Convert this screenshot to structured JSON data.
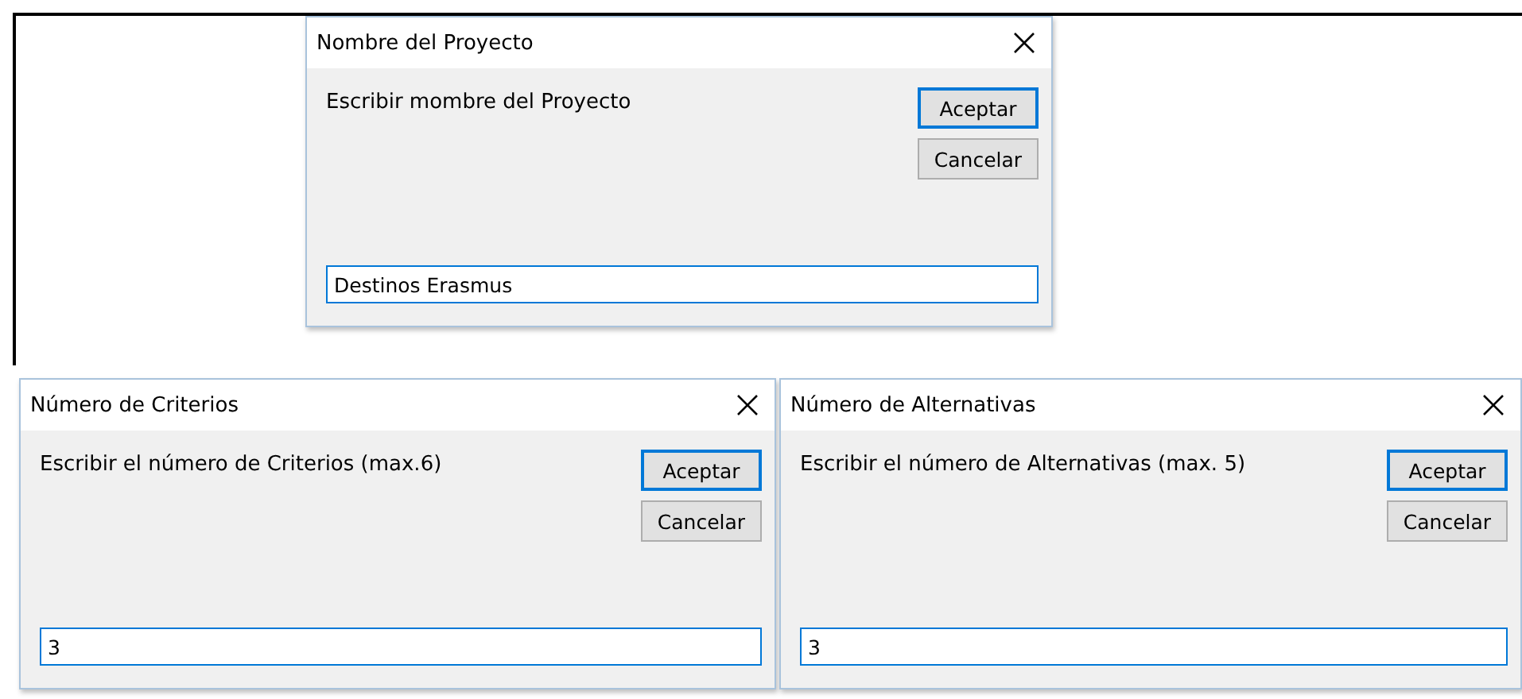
{
  "dialogs": [
    {
      "title": "Nombre del Proyecto",
      "prompt": "Escribir mombre del Proyecto",
      "buttons": [
        {
          "label": "Aceptar",
          "default": true
        },
        {
          "label": "Cancelar",
          "default": false
        }
      ],
      "value": "Destinos Erasmus"
    },
    {
      "title": "Número de Criterios",
      "prompt": "Escribir el número de Criterios (max.6)",
      "buttons": [
        {
          "label": "Aceptar",
          "default": true
        },
        {
          "label": "Cancelar",
          "default": false
        }
      ],
      "value": "3"
    },
    {
      "title": "Número de Alternativas",
      "prompt": "Escribir el número de Alternativas (max. 5)",
      "buttons": [
        {
          "label": "Aceptar",
          "default": true
        },
        {
          "label": "Cancelar",
          "default": false
        }
      ],
      "value": "3"
    }
  ]
}
